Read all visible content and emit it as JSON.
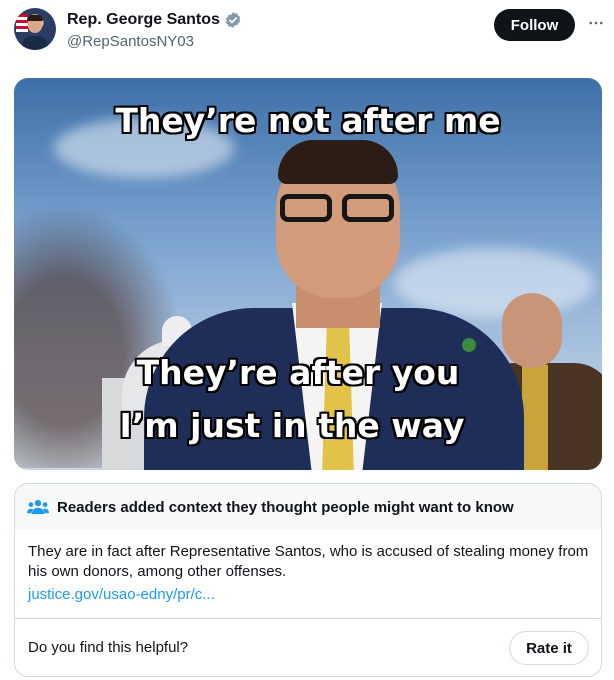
{
  "author": {
    "display_name": "Rep. George Santos",
    "handle": "@RepSantosNY03",
    "verified_icon": "verified-badge-icon"
  },
  "actions": {
    "follow_label": "Follow",
    "more_icon": "more-horizontal-icon"
  },
  "media": {
    "top_text": "They’re not after me",
    "bottom_text_line1": "They’re after you",
    "bottom_text_line2": "I’m just in the way"
  },
  "community_note": {
    "title": "Readers added context they thought people might want to know",
    "body": "They are in fact after Representative Santos, who is accused of stealing money from his own donors, among other offenses.",
    "link": "justice.gov/usao-edny/pr/c...",
    "question": "Do you find this helpful?",
    "rate_label": "Rate it",
    "icon": "people-icon"
  },
  "colors": {
    "link": "#1d9bf0",
    "verified": "#829aab",
    "text_primary": "#0f1419",
    "text_secondary": "#536471"
  }
}
